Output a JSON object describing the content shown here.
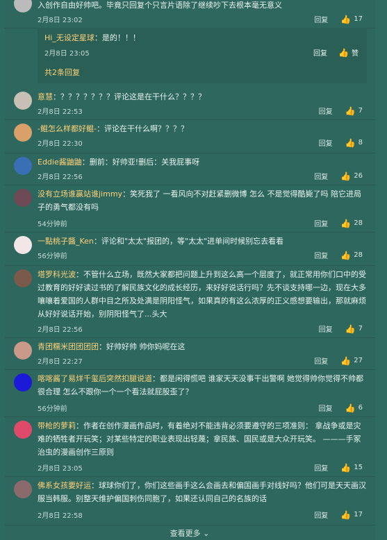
{
  "top": {
    "text": "入创作自由好帅吧。毕竟只回复个只言片语除了继续吵下去根本毫无意义",
    "time": "2月8日 23:02",
    "reply": "回复",
    "likes": "17"
  },
  "subreply": {
    "name": "Hi_无设定星球",
    "text": "：是的！！！",
    "time": "2月8日 23:05",
    "reply": "回复",
    "like_label": "赞",
    "total": "共2条回复"
  },
  "comments": [
    {
      "name": "意慧",
      "text": "：？？？？？？？评论这是在干什么？？？？",
      "time": "2月8日 22:53",
      "reply": "回复",
      "likes": "7",
      "avatar": "#c9c0b5"
    },
    {
      "name": "-鲲怎么样都好鲲-",
      "text": "：评论在干什么啊？？？？",
      "time": "2月8日 22:30",
      "reply": "回复",
      "likes": "8",
      "avatar": "#d9a06a"
    },
    {
      "name": "Eddie酱鼬鼬",
      "text": "：删前：好帅亚!删后：关我屁事呀",
      "time": "2月8日 22:56",
      "reply": "回复",
      "likes": "26",
      "avatar": "#3b6fb5"
    },
    {
      "name": "没有立场谁赢站谁jimmy",
      "text": "：笑死我了 一看风向不对赶紧删微博 怎么 不是觉得酷毙了吗 陪它进局子的勇气都没有吗",
      "time": "54分钟前",
      "reply": "回复",
      "likes": "28",
      "avatar": "#6d4a55"
    },
    {
      "name": "一點桃子醬_Ken",
      "text": "：评论和\"太太\"报团的，等\"太太\"进单间时候别忘去看看",
      "time": "56分钟前",
      "reply": "回复",
      "likes": "28",
      "avatar": "#f2e6e6"
    },
    {
      "name": "塔罗科光波",
      "text": "：不管什么立场，既然大家都把问题上升到这么高一个层度了，就正常用你们口中的受过教育的好好读过书的了解民族文化的成长经历，来好好说话行吗？先不谈支持哪一边，现在大多嚷嚷着爱国的人群中目之所及处满是阴阳怪气，如果真的有这么浓厚的正义感想要输出，那就麻烦从好好说话开始，别阴阳怪气了...头大",
      "time": "2月8日 22:56",
      "reply": "回复",
      "likes": "7",
      "avatar": "#7a5a4a"
    },
    {
      "name": "青团糯米团团团团",
      "text": "：好帅好帅 帅你妈呢在这",
      "time": "2月8日 22:27",
      "reply": "回复",
      "likes": "27",
      "avatar": "#c99a8a"
    },
    {
      "name": "喀喀酱了易烊千玺后突然扣腿说道",
      "text": "：都是闲得慌吧 谁家天天没事干出警啊 她觉得帅你觉得不帅都很合理 怎么不跟你一个一个看法就屁股歪了？",
      "time": "56分钟前",
      "reply": "回复",
      "likes": "6",
      "avatar": "#1a1ad8"
    },
    {
      "name": "带枪的萝莉",
      "text": "：作者在创作漫画作品时，有着绝对不能违背必须要遵守的三项准则： 拿战争或是灾难的牺牲者开玩笑；对某些特定的职业表现出轻蔑；拿民族、国民或是大众开玩笑。 ———手冢治虫的漫画创作三原则",
      "time": "2月8日 23:05",
      "reply": "回复",
      "likes": "15",
      "avatar": "#e04a6a"
    },
    {
      "name": "佛系女孩要好运",
      "text": "：球球你们了，你们这些画手这么会画去和偏国画手对线好吗？他们可是天天画汉服当韩服。别整天维护偏国刺伤同胞了，如果还认同自己的名族的话",
      "time": "2月8日 22:58",
      "reply": "回复",
      "likes": "17",
      "avatar": "#8a6a6a"
    }
  ],
  "footer": {
    "more": "查看更多"
  }
}
